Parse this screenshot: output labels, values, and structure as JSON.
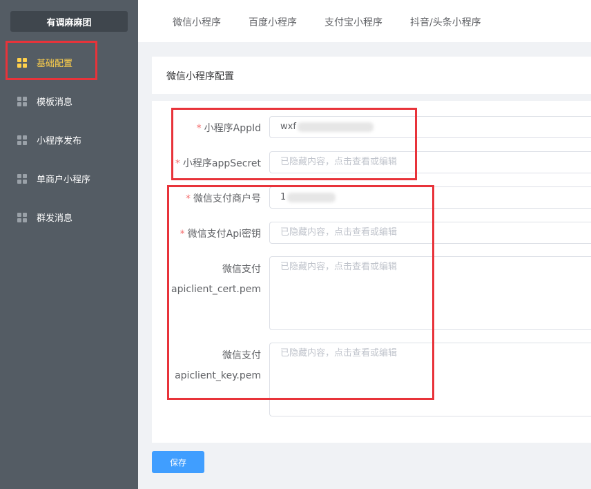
{
  "sidebar": {
    "brand": "有调麻麻团",
    "items": [
      {
        "label": "基础配置",
        "active": true
      },
      {
        "label": "模板消息",
        "active": false
      },
      {
        "label": "小程序发布",
        "active": false
      },
      {
        "label": "单商户小程序",
        "active": false
      },
      {
        "label": "群发消息",
        "active": false
      }
    ]
  },
  "tabs": [
    "微信小程序",
    "百度小程序",
    "支付宝小程序",
    "抖音/头条小程序"
  ],
  "card": {
    "title": "微信小程序配置"
  },
  "form": {
    "required_mark": "*",
    "appid": {
      "label": "小程序AppId",
      "value": "wxf"
    },
    "appsecret": {
      "label": "小程序appSecret",
      "placeholder": "已隐藏内容，点击查看或编辑"
    },
    "mchid": {
      "label": "微信支付商户号",
      "value": "1"
    },
    "apikey": {
      "label": "微信支付Api密钥",
      "placeholder": "已隐藏内容，点击查看或编辑"
    },
    "cert": {
      "label_line1": "微信支付",
      "label_line2": "apiclient_cert.pem",
      "placeholder": "已隐藏内容，点击查看或编辑"
    },
    "key": {
      "label_line1": "微信支付",
      "label_line2": "apiclient_key.pem",
      "placeholder": "已隐藏内容，点击查看或编辑"
    }
  },
  "save_label": "保存",
  "colors": {
    "sidebar_bg": "#545c64",
    "active": "#ffd04b",
    "primary": "#409eff",
    "highlight": "#e8333a"
  }
}
